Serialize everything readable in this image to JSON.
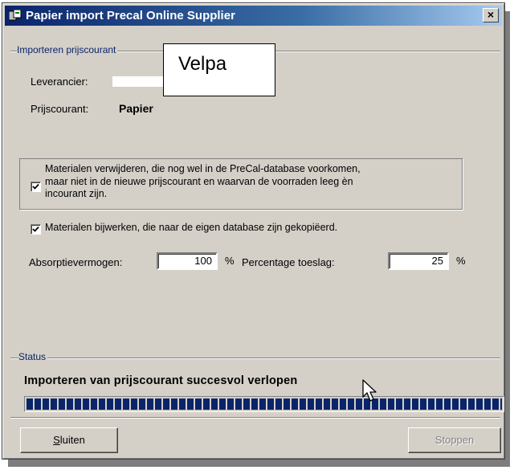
{
  "window": {
    "title": "Papier import Precal Online Supplier",
    "close_glyph": "×"
  },
  "import_group": {
    "label": "Importeren prijscourant",
    "supplier_label": "Leverancier:",
    "supplier_callout": "Velpa",
    "pricelist_label": "Prijscourant:",
    "pricelist_value": "Papier"
  },
  "options": {
    "remove_materials": {
      "checked": true,
      "lines": [
        "Materialen verwijderen, die nog wel in de PreCal-database voorkomen,",
        "maar niet in de nieuwe prijscourant en waarvan de voorraden leeg èn",
        "incourant zijn."
      ]
    },
    "update_materials": {
      "checked": true,
      "label": "Materialen bijwerken, die naar de eigen database zijn gekopiëerd."
    }
  },
  "fields": {
    "absorption_label": "Absorptievermogen:",
    "absorption_value": "100",
    "absorption_unit": "%",
    "surcharge_label": "Percentage toeslag:",
    "surcharge_value": "25",
    "surcharge_unit": "%"
  },
  "status_group": {
    "label": "Status",
    "message": "Importeren van prijscourant succesvol verlopen",
    "progress": 1.0
  },
  "buttons": {
    "close_prefix": "S",
    "close_rest": "luiten",
    "stop": "Stoppen"
  },
  "colors": {
    "titlebar_start": "#0a246a",
    "titlebar_end": "#a6caf0",
    "face": "#d4d0c8",
    "progress": "#0a246a"
  },
  "icons": {
    "window": "app-icon",
    "close": "close-icon",
    "check": "check-icon",
    "pointer": "mouse-pointer-icon"
  }
}
